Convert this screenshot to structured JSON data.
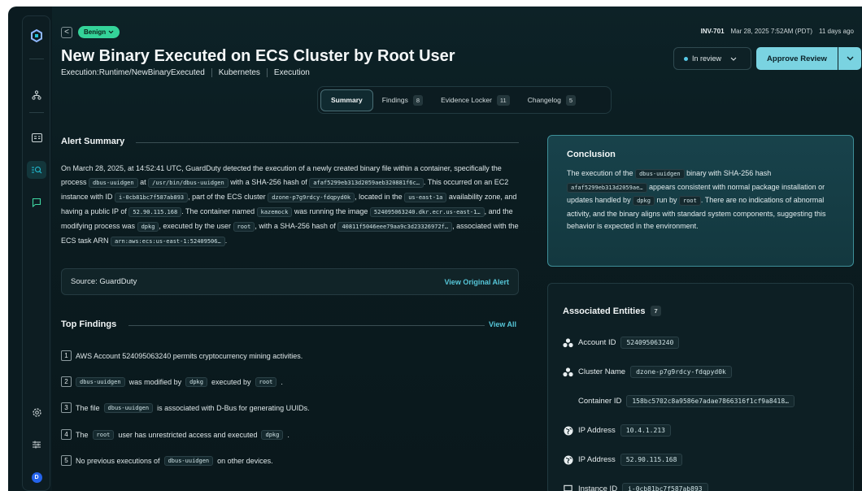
{
  "nav": {
    "logo_icon": "logo-icon",
    "items": [
      "topology-icon",
      "dashboard-icon",
      "investigations-icon",
      "chat-icon"
    ],
    "bottom": [
      "settings-icon",
      "filters-icon",
      "user-avatar"
    ],
    "avatar_label": "D",
    "accent": "#22c1d8"
  },
  "header": {
    "back_label": "<",
    "verdict": "Benign",
    "title": "New Binary Executed on ECS Cluster by Root User",
    "subtitle": [
      "Execution:Runtime/NewBinaryExecuted",
      "Kubernetes",
      "Execution"
    ],
    "id": "INV-701",
    "timestamp": "Mar 28, 2025 7:52AM (PDT)",
    "age": "11 days ago",
    "status": "In review",
    "approve_label": "Approve Review"
  },
  "tabs": [
    {
      "label": "Summary",
      "count": ""
    },
    {
      "label": "Findings",
      "count": "8"
    },
    {
      "label": "Evidence Locker",
      "count": "11"
    },
    {
      "label": "Changelog",
      "count": "5"
    }
  ],
  "alert_summary": {
    "title": "Alert Summary",
    "t1": "On March 28, 2025, at 14:52:41 UTC, GuardDuty detected the execution of a newly created binary file within a container, specifically the process",
    "c1": "dbus-uuidgen",
    "t2": "at",
    "c2": "/usr/bin/dbus-uuidgen",
    "t3": "with a SHA-256 hash of",
    "c3": "afaf5299eb313d2059aeb320881f6c…",
    "t4": ". This occurred on an EC2 instance with ID",
    "c4": "i-0cb81bc7f587ab893",
    "t5": ", part of the ECS cluster",
    "c5": "dzone-p7g9rdcy-fdqpyd0k",
    "t6": ", located in the",
    "c6": "us-east-1a",
    "t7": "availability zone, and having a public IP of",
    "c7": "52.90.115.168",
    "t8": ". The container named",
    "c8": "kazemock",
    "t9": "was running the image",
    "c9": "524095063240.dkr.ecr.us-east-1…",
    "t10": ", and the modifying process was",
    "c10": "dpkg",
    "t11": ", executed by the user",
    "c11": "root",
    "t12": ", with a SHA-256 hash of",
    "c12": "40811f5046eee79aa9c3d23326972f…",
    "t13": ", associated with the ECS task ARN",
    "c13": "arn:aws:ecs:us-east-1:52409506…",
    "t14": "."
  },
  "source": {
    "label": "Source: GuardDuty",
    "link": "View Original Alert"
  },
  "top_findings": {
    "title": "Top Findings",
    "view_all": "View All",
    "f1": {
      "n": "1",
      "text": "AWS Account 524095063240 permits cryptocurrency mining activities."
    },
    "f2": {
      "n": "2",
      "c1": "dbus-uuidgen",
      "t1": "was modified by",
      "c2": "dpkg",
      "t2": "executed by",
      "c3": "root",
      "t3": "."
    },
    "f3": {
      "n": "3",
      "t0": "The file",
      "c1": "dbus-uuidgen",
      "t1": "is associated with D-Bus for generating UUIDs."
    },
    "f4": {
      "n": "4",
      "t0": "The",
      "c1": "root",
      "t1": "user has unrestricted access and executed",
      "c2": "dpkg",
      "t2": "."
    },
    "f5": {
      "n": "5",
      "t0": "No previous executions of",
      "c1": "dbus-uuidgen",
      "t1": "on other devices."
    }
  },
  "conclusion": {
    "title": "Conclusion",
    "t1": "The execution of the",
    "c1": "dbus-uuidgen",
    "t2": "binary with SHA-256 hash",
    "c2": "afaf5299eb313d2059ae…",
    "t3": "appears consistent with normal package installation or updates handled by",
    "c3": "dpkg",
    "t4": "run by",
    "c4": "root",
    "t5": ". There are no indications of abnormal activity, and the binary aligns with standard system components, suggesting this behavior is expected in the environment."
  },
  "entities": {
    "title": "Associated Entities",
    "count": "7",
    "items": [
      {
        "icon": "aws-icon",
        "label": "Account ID",
        "value": "524095063240"
      },
      {
        "icon": "aws-icon",
        "label": "Cluster Name",
        "value": "dzone-p7g9rdcy-fdqpyd0k"
      },
      {
        "icon": "",
        "label": "Container ID",
        "value": "158bc5702c8a9586e7adae7866316f1cf9a8418…"
      },
      {
        "icon": "globe-icon",
        "label": "IP Address",
        "value": "10.4.1.213"
      },
      {
        "icon": "globe-icon",
        "label": "IP Address",
        "value": "52.90.115.168"
      },
      {
        "icon": "laptop-icon",
        "label": "Instance ID",
        "value": "i-0cb81bc7f587ab893"
      }
    ]
  }
}
